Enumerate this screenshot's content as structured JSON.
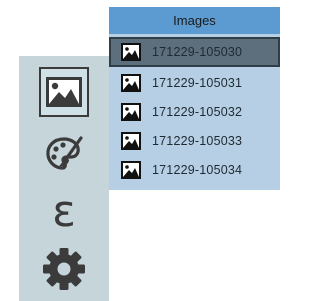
{
  "panel": {
    "title": "Images",
    "items": [
      {
        "label": "171229-105030",
        "selected": true
      },
      {
        "label": "171229-105031",
        "selected": false
      },
      {
        "label": "171229-105032",
        "selected": false
      },
      {
        "label": "171229-105033",
        "selected": false
      },
      {
        "label": "171229-105034",
        "selected": false
      }
    ]
  },
  "toolbar": {
    "tools": [
      {
        "icon": "image-icon",
        "active": true
      },
      {
        "icon": "palette-icon",
        "active": false
      },
      {
        "icon": "epsilon-icon",
        "glyph": "ɛ",
        "active": false
      },
      {
        "icon": "gear-icon",
        "active": false
      }
    ]
  },
  "colors": {
    "toolbar_bg": "#c5d5d9",
    "panel_bg": "#b6cfe4",
    "header_bg": "#5b9bd1",
    "selected_bg": "#5d6f7d",
    "icon_dark": "#3b3b3b"
  }
}
